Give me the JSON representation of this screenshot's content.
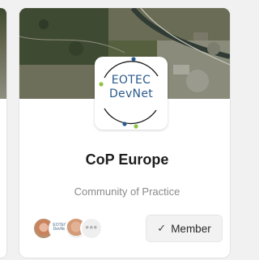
{
  "card": {
    "logo": {
      "line1": "EOTEC",
      "line2": "DevNet",
      "accent_colors": [
        "#2b5a8c",
        "#8cc63f",
        "#1b1b1b"
      ]
    },
    "title": "CoP Europe",
    "subtitle": "Community of Practice",
    "members": {
      "avatars": [
        {
          "name": "member-avatar-1",
          "mini_logo": ""
        },
        {
          "name": "member-avatar-2",
          "mini_logo": "EOTEC DevNet"
        },
        {
          "name": "member-avatar-3",
          "mini_logo": ""
        }
      ],
      "more_label": "•••"
    },
    "member_button": {
      "icon": "check-icon",
      "label": "Member"
    }
  }
}
